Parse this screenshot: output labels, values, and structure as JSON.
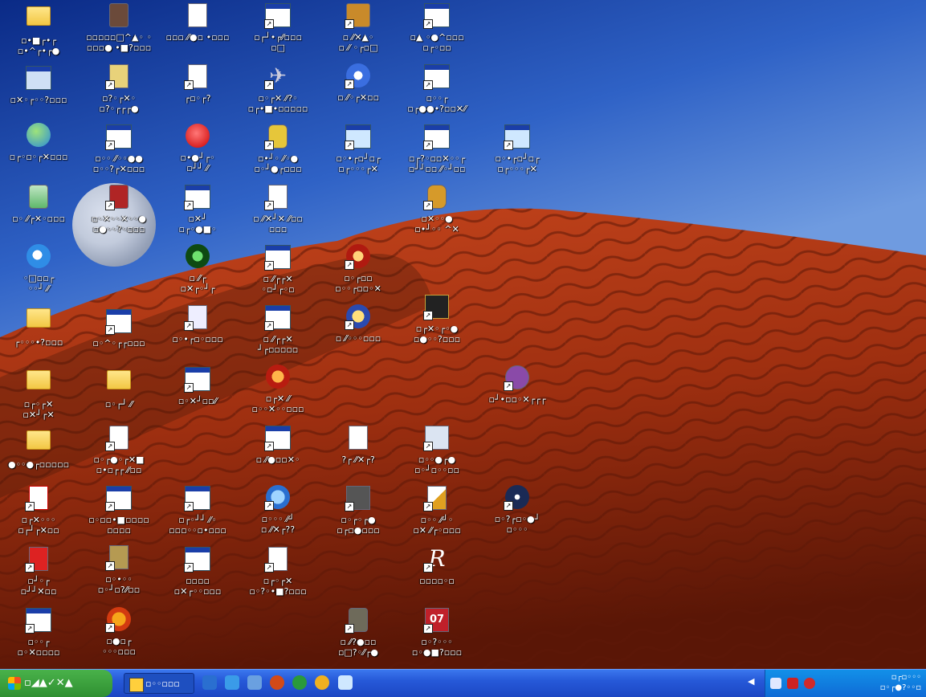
{
  "desktop": {
    "icons": [
      {
        "label": "▫•■┌•┌\n▫•^┌•┌●"
      },
      {
        "label": "▫▫▫▫▫□^▲◦ ◦\n▫▫▫● •■?▫▫▫"
      },
      {
        "label": "▫▫▫ ⁄⁄●▫ •▫▫▫"
      },
      {
        "label": "▫┌┘•┌⁄⁄▫▫▫\n▫□"
      },
      {
        "label": "▫ ⁄⁄✕▲◦\n▫ ⁄⁄ ◦┌▫□"
      },
      {
        "label": "▫▲ ◦●^▫▫▫\n▫┌◦▫▫"
      },
      {
        "label": "▫✕◦┌◦◦?▫▫▫"
      },
      {
        "label": "▫?◦┌✕◦\n▫?◦┌┌┌●"
      },
      {
        "label": "┌▫◦┌?"
      },
      {
        "label": "▫◦┌✕ ⁄⁄?◦\n▫┌•■•▫▫▫▫▫"
      },
      {
        "label": "▫ ⁄⁄◦┌✕▫▫"
      },
      {
        "label": "▫◦◦┌\n▫┌●●•?▫▫✕⁄⁄"
      },
      {
        "label": "▫┌◦▫◦┌✕▫▫▫"
      },
      {
        "label": "▫◦◦ ⁄⁄◦◦●●\n▫◦◦?┌✕▫▫▫"
      },
      {
        "label": "▫•●┘┌◦\n▫┘┘ ⁄⁄"
      },
      {
        "label": "▫•┘◦ ⁄⁄◦●\n▫◦┘●┌▫▫▫"
      },
      {
        "label": "▫◦•┌▫┘▫┌\n▫┌◦◦◦┌✕"
      },
      {
        "label": "▫┌?◦▫▫✕◦◦┌\n▫┘┘▫▫ ⁄⁄◦┘▫▫"
      },
      {
        "label": "▫◦•┌▫┘▫┌\n▫┌◦◦◦┌✕"
      },
      {
        "label": "▫◦ ⁄⁄┌✕◦▫▫▫"
      },
      {
        "label": "▫◦✕◦◦✕◦◦●\n▫●◦◦?◦▫▫▫"
      },
      {
        "label": "▫✕┘\n▫┌◦●■◦"
      },
      {
        "label": "▫ ⁄⁄✕┘✕ ⁄⁄▫▫\n▫▫▫"
      },
      {
        "label": "▫✕◦◦●\n▫•┘◦◦ ^✕"
      },
      {
        "label": "◦□▫▫┌\n◦◦┘ ⁄⁄"
      },
      {
        "label": "▫ ⁄⁄┌\n▫✕┌◦┘┌"
      },
      {
        "label": "▫ ⁄⁄┌┌✕\n◦▫┘┌◦▫"
      },
      {
        "label": "▫◦┌▫▫\n▫◦◦┌▫▫◦✕"
      },
      {
        "label": "┌◦◦◦•?▫▫▫"
      },
      {
        "label": "▫◦^◦┌┌▫▫▫"
      },
      {
        "label": "▫◦•┌▫◦▫▫▫"
      },
      {
        "label": "▫ ⁄⁄┌┌✕\n┘┌▫▫▫▫▫"
      },
      {
        "label": "▫ ⁄⁄◦◦◦▫▫▫"
      },
      {
        "label": "▫┌✕◦┌◦●\n▫●◦◦?▫▫▫"
      },
      {
        "label": "▫┌◦┌✕\n▫✕┘┌✕"
      },
      {
        "label": "▫◦┌┘ ⁄⁄"
      },
      {
        "label": "▫◦✕┘▫▫⁄⁄"
      },
      {
        "label": "▫┌✕ ⁄⁄\n▫◦◦✕◦◦▫▫▫"
      },
      {
        "label": "▫┘•▫▫◦✕┌┌┌"
      },
      {
        "label": "●◦◦●┌▫▫▫▫▫"
      },
      {
        "label": "▫◦┌●◦┌✕■\n▫•▫┌┌ ⁄⁄▫▫"
      },
      {
        "label": "▫ ⁄⁄●▫▫✕◦"
      },
      {
        "label": "?┌ ⁄⁄✕┌?"
      },
      {
        "label": "▫◦◦●┌●\n▫◦┘▫◦◦▫▫"
      },
      {
        "label": "▫┌✕◦◦◦\n▫┌┘┌✕▫▫"
      },
      {
        "label": "▫◦▫▫•■▫▫▫▫\n▫▫▫▫"
      },
      {
        "label": "▫┌◦┘┘ ⁄⁄◦\n▫▫▫◦◦▫•▫▫▫"
      },
      {
        "label": "▫◦◦◦ ⁄⁄┘\n▫ ⁄⁄✕┌??"
      },
      {
        "label": "▫◦┌◦┌●\n▫┌▫●▫▫▫"
      },
      {
        "label": "▫◦◦ ⁄⁄┘◦\n▫✕ ⁄⁄┌◦▫▫▫"
      },
      {
        "label": "▫◦?┌▫◦●┘\n▫◦◦◦"
      },
      {
        "label": "▫┘◦┌\n▫┘┘✕▫▫"
      },
      {
        "label": "▫◦•◦◦\n▫◦┘▫?⁄⁄▫▫"
      },
      {
        "label": "▫▫▫▫\n▫✕┌◦◦▫▫▫"
      },
      {
        "label": "▫┌◦┌✕\n▫◦?◦•■?▫▫▫"
      },
      {
        "label": "▫▫▫▫◦▫"
      },
      {
        "label": "▫◦◦┌\n▫◦✕▫▫▫▫"
      },
      {
        "label": "▫●▫┌\n◦◦◦▫▫▫"
      },
      {
        "label": "▫ ⁄⁄?●▫▫\n▫□?◦⁄⁄┌●"
      },
      {
        "label": "▫◦?◦◦◦\n▫◦●■?▫▫▫"
      }
    ]
  },
  "taskbar": {
    "start_label": "▫◢▲✓✕▲",
    "task_label": "▫◦◦▫▫▫",
    "tray_toggle": "◀",
    "clock_line1": "▫┌▫◦◦◦",
    "clock_line2": "▫◦┌●?◦◦▫"
  }
}
